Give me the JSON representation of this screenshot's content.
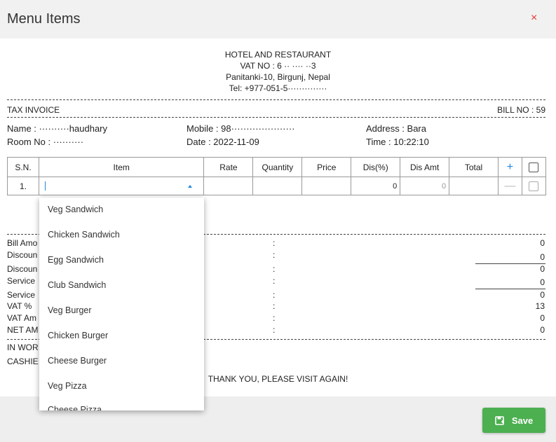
{
  "dialog": {
    "title": "Menu Items",
    "close": "×"
  },
  "bill_header": {
    "name": "HOTEL AND RESTAURANT",
    "vat": "VAT NO : 6 ·· ···· ··3",
    "address": "Panitanki-10, Birgunj, Nepal",
    "tel": "Tel: +977-051-5··············"
  },
  "invoice": {
    "type": "TAX INVOICE",
    "bill_no": "BILL NO : 59",
    "name": "Name : ··········haudhary",
    "mobile": "Mobile : 98·····················",
    "address": "Address : Bara",
    "room": "Room No : ··········",
    "date": "Date : 2022-11-09",
    "time": "Time : 10:22:10"
  },
  "table": {
    "headers": [
      "S.N.",
      "Item",
      "Rate",
      "Quantity",
      "Price",
      "Dis(%)",
      "Dis Amt",
      "Total"
    ],
    "add": "+",
    "rows": [
      {
        "sn": "1.",
        "dis_pct": "0",
        "dis_amt": "0",
        "remove": "—"
      }
    ]
  },
  "summary": {
    "labels": [
      "Bill Amo",
      "Discoun",
      "Discoun",
      "Service",
      "Service",
      "VAT %",
      "VAT Am",
      "NET AM"
    ],
    "colon": ":",
    "values": [
      "0",
      "0",
      "0",
      "0",
      "0",
      "13",
      "0",
      "0"
    ],
    "in_words": "IN WOR",
    "cashier": "CASHIE",
    "thanks": "THANK YOU, PLEASE VISIT AGAIN!"
  },
  "dropdown": {
    "options": [
      "Veg Sandwich",
      "Chicken Sandwich",
      "Egg Sandwich",
      "Club Sandwich",
      "Veg Burger",
      "Chicken Burger",
      "Cheese Burger",
      "Veg Pizza",
      "Cheese Pizza"
    ]
  },
  "footer": {
    "save_label": "Save"
  },
  "colors": {
    "accent": "#1e88e5",
    "save": "#4caf50",
    "close": "#e53935"
  }
}
